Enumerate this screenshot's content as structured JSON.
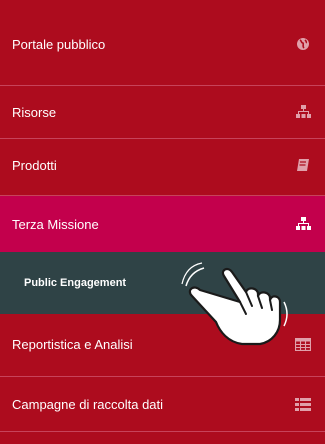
{
  "menu": {
    "items": [
      {
        "label": "Portale pubblico",
        "icon": "globe-icon"
      },
      {
        "label": "Risorse",
        "icon": "sitemap-icon"
      },
      {
        "label": "Prodotti",
        "icon": "book-icon"
      },
      {
        "label": "Terza Missione",
        "icon": "sitemap-icon",
        "active": true
      },
      {
        "label": "Reportistica e Analisi",
        "icon": "table-icon"
      },
      {
        "label": "Campagne di raccolta dati",
        "icon": "list-icon"
      }
    ],
    "subitem": {
      "label": "Public Engagement"
    }
  },
  "colors": {
    "menu_bg": "#ad0c1e",
    "active_bg": "#c3004c",
    "submenu_bg": "#2f4346",
    "icon_muted": "#e0a0aa"
  },
  "cursor_icon": "hand-pointer-icon"
}
